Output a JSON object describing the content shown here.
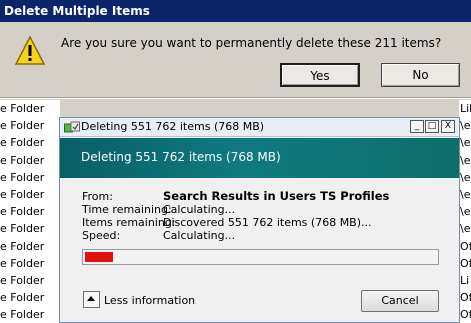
{
  "confirm": {
    "title": "Delete Multiple Items",
    "question": "Are you sure you want to permanently delete these 211 items?",
    "yes_label": "Yes",
    "no_label": "No",
    "icon": "warning-icon"
  },
  "file_list": {
    "rows": [
      "e Folder",
      "e Folder",
      "e Folder",
      "e Folder",
      "e Folder",
      "e Folder",
      "e Folder",
      "e Folder",
      "e Folder",
      "e Folder",
      "e Folder",
      "e Folder",
      "e Folder"
    ],
    "right_fragments": [
      "Lib",
      "\\e",
      "\\e",
      "\\e",
      "\\e",
      "\\e",
      "\\e",
      "\\e",
      "Of",
      "Of",
      "Li",
      "Of",
      "Of"
    ]
  },
  "progress": {
    "window_title": "Deleting 551 762 items (768 MB)",
    "heading": "Deleting 551 762 items (768 MB)",
    "from_label": "From:",
    "from_value": "Search Results in Users TS Profiles",
    "time_label": "Time remaining:",
    "time_value": "Calculating...",
    "items_label": "Items remaining:",
    "items_value": "Discovered 551 762 items (768 MB)...",
    "speed_label": "Speed:",
    "speed_value": "Calculating...",
    "progress_fraction": 0.02,
    "progress_color": "#e01010",
    "less_info_label": "Less information",
    "cancel_label": "Cancel",
    "minimize_glyph": "_",
    "maximize_glyph": "□",
    "close_glyph": "X"
  },
  "colors": {
    "title_bar": "#0b246a",
    "banner": "#0e7a80",
    "window_bg": "#d4d0c8"
  }
}
